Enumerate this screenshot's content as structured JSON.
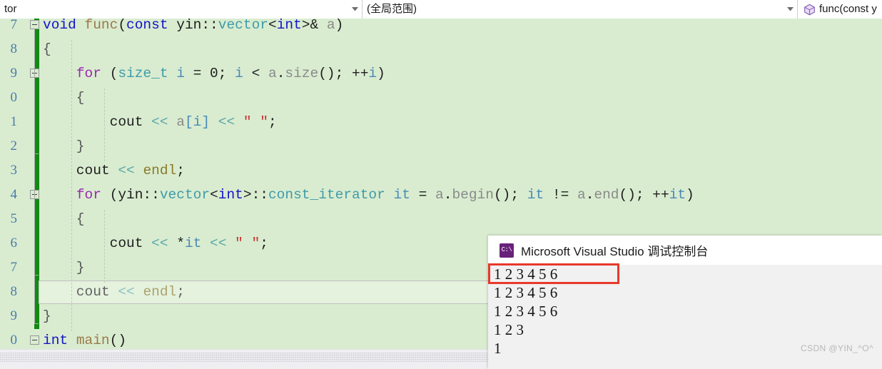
{
  "navbar": {
    "project_dropdown": {
      "value": "tor",
      "icon": "chevron-down-icon"
    },
    "scope_dropdown": {
      "value": "(全局范围)",
      "icon": "chevron-down-icon"
    },
    "member_dropdown": {
      "value": "func(const y",
      "icon": "cube-icon"
    }
  },
  "editor": {
    "line_numbers": [
      "7",
      "8",
      "9",
      "0",
      "1",
      "2",
      "3",
      "4",
      "5",
      "6",
      "7",
      "8",
      "9",
      "0"
    ],
    "lines": [
      {
        "n": 0,
        "segments": [
          {
            "t": "void",
            "c": "t-kw"
          },
          {
            "t": " ",
            "c": "t-pl"
          },
          {
            "t": "func",
            "c": "t-fn"
          },
          {
            "t": "(",
            "c": "t-pl"
          },
          {
            "t": "const",
            "c": "t-kw"
          },
          {
            "t": " yin::",
            "c": "t-pl"
          },
          {
            "t": "vector",
            "c": "t-type"
          },
          {
            "t": "<",
            "c": "t-pl"
          },
          {
            "t": "int",
            "c": "t-kw"
          },
          {
            "t": ">& ",
            "c": "t-pl"
          },
          {
            "t": "a",
            "c": "t-id"
          },
          {
            "t": ")",
            "c": "t-pl"
          }
        ]
      },
      {
        "n": 1,
        "segments": [
          {
            "t": "{",
            "c": "t-blk"
          }
        ]
      },
      {
        "n": 2,
        "segments": [
          {
            "t": "    ",
            "c": "t-pl"
          },
          {
            "t": "for",
            "c": "t-for"
          },
          {
            "t": " (",
            "c": "t-pl"
          },
          {
            "t": "size_t",
            "c": "t-type"
          },
          {
            "t": " ",
            "c": "t-pl"
          },
          {
            "t": "i",
            "c": "t-var"
          },
          {
            "t": " = 0; ",
            "c": "t-pl"
          },
          {
            "t": "i",
            "c": "t-var"
          },
          {
            "t": " < ",
            "c": "t-pl"
          },
          {
            "t": "a",
            "c": "t-id"
          },
          {
            "t": ".",
            "c": "t-pl"
          },
          {
            "t": "size",
            "c": "t-id"
          },
          {
            "t": "(); ++",
            "c": "t-pl"
          },
          {
            "t": "i",
            "c": "t-var"
          },
          {
            "t": ")",
            "c": "t-pl"
          }
        ]
      },
      {
        "n": 3,
        "segments": [
          {
            "t": "    {",
            "c": "t-blk"
          }
        ]
      },
      {
        "n": 4,
        "segments": [
          {
            "t": "        cout ",
            "c": "t-pl"
          },
          {
            "t": "<<",
            "c": "t-op"
          },
          {
            "t": " ",
            "c": "t-pl"
          },
          {
            "t": "a",
            "c": "t-id"
          },
          {
            "t": "[",
            "c": "t-var"
          },
          {
            "t": "i",
            "c": "t-var"
          },
          {
            "t": "]",
            "c": "t-var"
          },
          {
            "t": " ",
            "c": "t-pl"
          },
          {
            "t": "<<",
            "c": "t-op"
          },
          {
            "t": " ",
            "c": "t-pl"
          },
          {
            "t": "\" \"",
            "c": "t-str"
          },
          {
            "t": ";",
            "c": "t-pl"
          }
        ]
      },
      {
        "n": 5,
        "segments": [
          {
            "t": "    }",
            "c": "t-blk"
          }
        ]
      },
      {
        "n": 6,
        "segments": [
          {
            "t": "    cout ",
            "c": "t-pl"
          },
          {
            "t": "<<",
            "c": "t-op"
          },
          {
            "t": " ",
            "c": "t-pl"
          },
          {
            "t": "endl",
            "c": "t-endl"
          },
          {
            "t": ";",
            "c": "t-pl"
          }
        ]
      },
      {
        "n": 7,
        "segments": [
          {
            "t": "    ",
            "c": "t-pl"
          },
          {
            "t": "for",
            "c": "t-for"
          },
          {
            "t": " (yin::",
            "c": "t-pl"
          },
          {
            "t": "vector",
            "c": "t-type"
          },
          {
            "t": "<",
            "c": "t-pl"
          },
          {
            "t": "int",
            "c": "t-kw"
          },
          {
            "t": ">::",
            "c": "t-pl"
          },
          {
            "t": "const_iterator",
            "c": "t-type"
          },
          {
            "t": " ",
            "c": "t-pl"
          },
          {
            "t": "it",
            "c": "t-var"
          },
          {
            "t": " = ",
            "c": "t-pl"
          },
          {
            "t": "a",
            "c": "t-id"
          },
          {
            "t": ".",
            "c": "t-pl"
          },
          {
            "t": "begin",
            "c": "t-id"
          },
          {
            "t": "(); ",
            "c": "t-pl"
          },
          {
            "t": "it",
            "c": "t-var"
          },
          {
            "t": " != ",
            "c": "t-pl"
          },
          {
            "t": "a",
            "c": "t-id"
          },
          {
            "t": ".",
            "c": "t-pl"
          },
          {
            "t": "end",
            "c": "t-id"
          },
          {
            "t": "(); ++",
            "c": "t-pl"
          },
          {
            "t": "it",
            "c": "t-var"
          },
          {
            "t": ")",
            "c": "t-pl"
          }
        ]
      },
      {
        "n": 8,
        "segments": [
          {
            "t": "    {",
            "c": "t-blk"
          }
        ]
      },
      {
        "n": 9,
        "segments": [
          {
            "t": "        cout ",
            "c": "t-pl"
          },
          {
            "t": "<<",
            "c": "t-op"
          },
          {
            "t": " *",
            "c": "t-pl"
          },
          {
            "t": "it",
            "c": "t-var"
          },
          {
            "t": " ",
            "c": "t-pl"
          },
          {
            "t": "<<",
            "c": "t-op"
          },
          {
            "t": " ",
            "c": "t-pl"
          },
          {
            "t": "\" \"",
            "c": "t-str"
          },
          {
            "t": ";",
            "c": "t-pl"
          }
        ]
      },
      {
        "n": 10,
        "segments": [
          {
            "t": "    }",
            "c": "t-blk"
          }
        ]
      },
      {
        "n": 11,
        "segments": [
          {
            "t": "    cout ",
            "c": "t-pl"
          },
          {
            "t": "<<",
            "c": "t-op"
          },
          {
            "t": " ",
            "c": "t-pl"
          },
          {
            "t": "endl",
            "c": "t-endl"
          },
          {
            "t": ";",
            "c": "t-pl"
          }
        ]
      },
      {
        "n": 12,
        "segments": [
          {
            "t": "}",
            "c": "t-blk"
          }
        ]
      },
      {
        "n": 13,
        "segments": [
          {
            "t": "int",
            "c": "t-kw"
          },
          {
            "t": " ",
            "c": "t-pl"
          },
          {
            "t": "main",
            "c": "t-fn"
          },
          {
            "t": "()",
            "c": "t-pl"
          }
        ]
      }
    ],
    "current_line_index": 11
  },
  "console": {
    "title": "Microsoft Visual Studio 调试控制台",
    "icon": "console-cmd-icon",
    "icon_glyph": "C:\\",
    "output_lines": [
      "1 2 3 4 5 6",
      "1 2 3 4 5 6",
      "1 2 3 4 5 6",
      "1 2 3",
      "1"
    ]
  },
  "annotation": {
    "highlight_color": "#e8392c",
    "highlights_line": "1 2 3 4 5 6"
  },
  "watermark": {
    "text": "CSDN @YIN_^O^"
  }
}
